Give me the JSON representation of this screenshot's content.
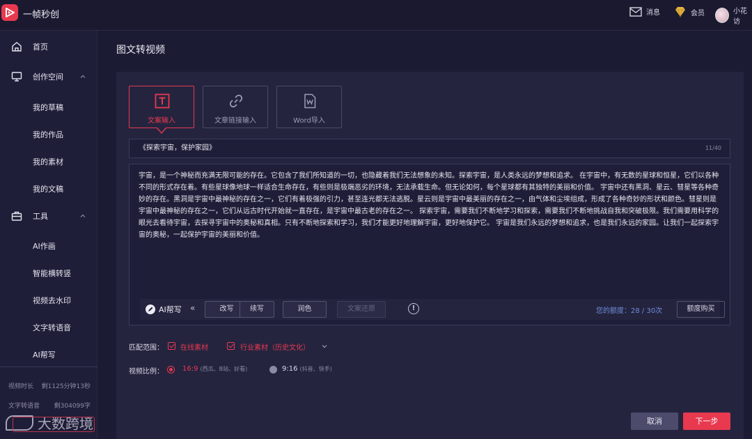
{
  "app": {
    "name": "一帧秒创"
  },
  "header": {
    "messages_label": "消息",
    "vip_label": "会员",
    "user_name": "小花访"
  },
  "sidebar": {
    "home": "首页",
    "workspace": "创作空间",
    "workspace_items": [
      "我的草稿",
      "我的作品",
      "我的素材",
      "我的文稿"
    ],
    "tools": "工具",
    "tools_items": [
      "AI作画",
      "智能横转竖",
      "视频去水印",
      "文字转语音",
      "AI帮写"
    ],
    "quota": [
      {
        "label": "视频时长",
        "value": "剩1125分钟13秒"
      },
      {
        "label": "文字转语音",
        "value": "剩304099字"
      }
    ],
    "watermark": "大数跨境"
  },
  "page": {
    "title": "图文转视频"
  },
  "tabs": [
    {
      "label": "文案输入",
      "icon": "text-icon",
      "active": true
    },
    {
      "label": "文章链接输入",
      "icon": "link-icon",
      "active": false
    },
    {
      "label": "Word导入",
      "icon": "word-icon",
      "active": false
    }
  ],
  "title_input": {
    "value": "《探索宇宙，保护家园》",
    "count": "11/40"
  },
  "content": {
    "text": "宇宙，是一个神秘而充满无限可能的存在。它包含了我们所知道的一切，也隐藏着我们无法想象的未知。探索宇宙，是人类永远的梦想和追求。 在宇宙中，有无数的星球和恒星，它们以各种不同的形式存在着。有些星球像地球一样适合生命存在，有些则是极端恶劣的环境，无法承载生命。但无论如何，每个星球都有其独特的美丽和价值。 宇宙中还有黑洞、星云、彗星等各种奇妙的存在。黑洞是宇宙中最神秘的存在之一，它们有着极强的引力，甚至连光都无法逃脱。星云则是宇宙中最美丽的存在之一，由气体和尘埃组成，形成了各种奇妙的形状和颜色。彗星则是宇宙中最神秘的存在之一，它们从远古时代开始就一直存在，是宇宙中最古老的存在之一。 探索宇宙，需要我们不断地学习和探索，需要我们不断地挑战自我和突破极限。我们需要用科学的眼光去看待宇宙，去探寻宇宙中的奥秘和真相。只有不断地探索和学习，我们才能更好地理解宇宙，更好地保护它。 宇宙是我们永远的梦想和追求，也是我们永远的家园。让我们一起探索宇宙的奥秘，一起保护宇宙的美丽和价值。"
  },
  "ai_bar": {
    "label": "AI帮写",
    "collapse": "«",
    "buttons": [
      "改写",
      "续写",
      "润色",
      "文案还原"
    ],
    "quota_text": "您的额度：28 / 30次",
    "buy_label": "额度购买"
  },
  "match": {
    "label": "匹配范围：",
    "options": [
      "在线素材",
      "行业素材（历史文化）"
    ]
  },
  "ratio": {
    "label": "视频比例：",
    "options": [
      {
        "value": "16:9",
        "sub": "(西瓜、B站、好看)",
        "selected": true
      },
      {
        "value": "9:16",
        "sub": "(抖音、快手)",
        "selected": false
      }
    ]
  },
  "footer": {
    "cancel": "取消",
    "next": "下一步"
  },
  "colors": {
    "accent": "#e8394f",
    "bg": "#1c1b34",
    "panel": "#25243f",
    "link": "#6d8cd8"
  }
}
